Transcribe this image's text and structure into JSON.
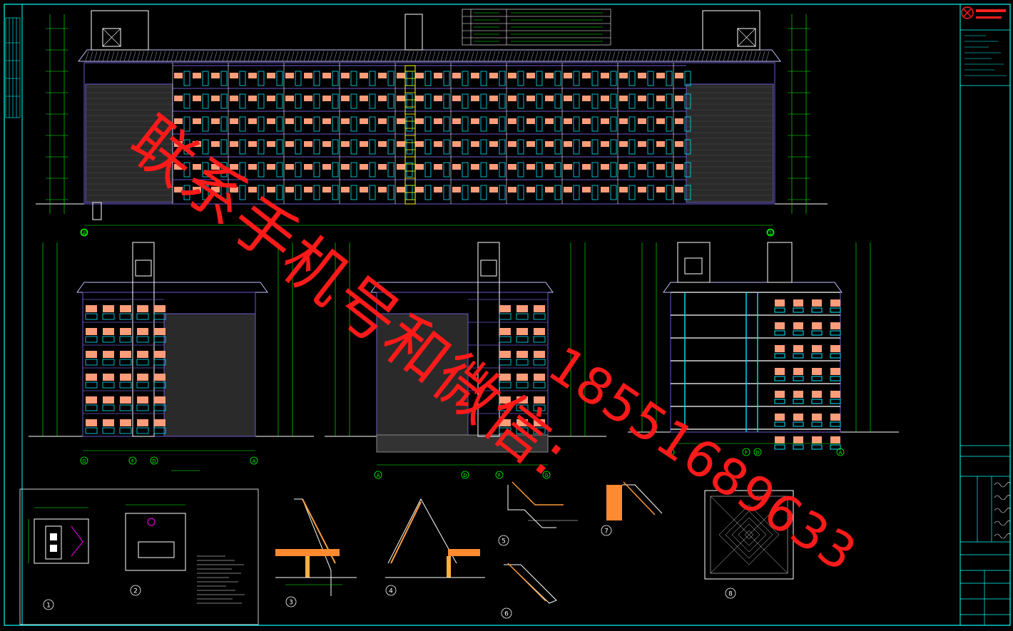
{
  "watermark": {
    "line1": "联系手机号和微信:",
    "line2": "18551689633"
  },
  "colors": {
    "background": "#000000",
    "frame": "#00ffff",
    "dimension": "#00ff00",
    "wall": "#6a5acd",
    "window": "#00e5ff",
    "balcony": "#ff9c7a",
    "stair": "#ffff00",
    "watermark": "#ff1a1a"
  },
  "detail_numbers": [
    "1",
    "2",
    "3",
    "4",
    "5",
    "6",
    "7",
    "8"
  ],
  "axis_bubbles": {
    "front": [
      "A",
      "1"
    ],
    "side_left": [
      "G",
      "F",
      "D",
      "A"
    ],
    "side_mid": [
      "A",
      "D",
      "F",
      "G"
    ],
    "section": [
      "G",
      "F",
      "D",
      "A"
    ]
  }
}
